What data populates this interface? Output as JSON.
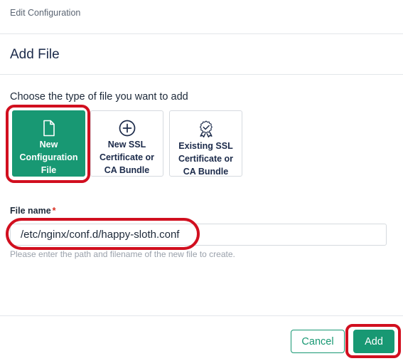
{
  "header": {
    "breadcrumb": "Edit Configuration",
    "title": "Add File"
  },
  "file_type": {
    "prompt": "Choose the type of file you want to add",
    "options": [
      {
        "label": "New Configuration File",
        "icon": "file-icon",
        "selected": true
      },
      {
        "label": "New SSL Certificate or CA Bundle",
        "icon": "plus-circle-icon",
        "selected": false
      },
      {
        "label": "Existing SSL Certificate or CA Bundle",
        "icon": "certificate-badge-icon",
        "selected": false
      }
    ]
  },
  "file_name": {
    "label": "File name",
    "required_marker": "*",
    "value": "/etc/nginx/conf.d/happy-sloth.conf",
    "helper": "Please enter the path and filename of the new file to create."
  },
  "footer": {
    "cancel_label": "Cancel",
    "add_label": "Add"
  },
  "colors": {
    "accent": "#189873",
    "highlight": "#d10f1f",
    "required": "#d92d20"
  }
}
